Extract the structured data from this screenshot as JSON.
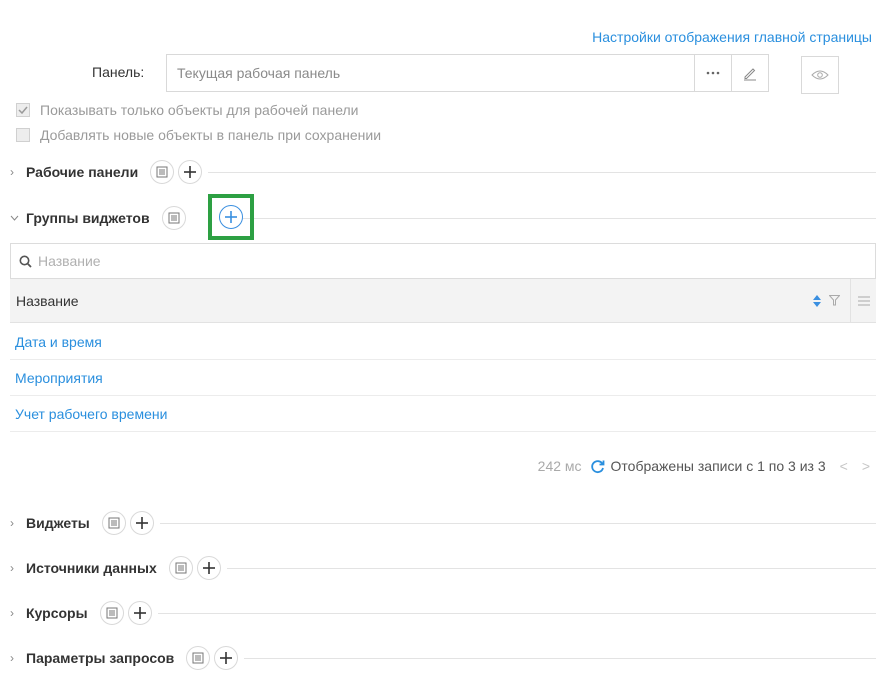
{
  "header": {
    "settings_link": "Настройки отображения главной страницы"
  },
  "panel": {
    "label": "Панель:",
    "value": "Текущая рабочая панель",
    "more_icon": "ellipsis-icon",
    "edit_icon": "pencil-icon",
    "view_icon": "eye-icon"
  },
  "options": {
    "show_only_panel_objects": {
      "label": "Показывать только объекты для рабочей панели",
      "checked": true
    },
    "add_new_to_panel": {
      "label": "Добавлять новые объекты в панель при сохранении",
      "checked": false
    }
  },
  "sections": {
    "panels": {
      "title": "Рабочие панели",
      "expanded": false
    },
    "groups": {
      "title": "Группы виджетов",
      "expanded": true
    },
    "widgets": {
      "title": "Виджеты",
      "expanded": false
    },
    "sources": {
      "title": "Источники данных",
      "expanded": false
    },
    "cursors": {
      "title": "Курсоры",
      "expanded": false
    },
    "params": {
      "title": "Параметры запросов",
      "expanded": false
    }
  },
  "groups_table": {
    "search_placeholder": "Название",
    "columns": [
      "Название"
    ],
    "rows": [
      {
        "name": "Дата и время"
      },
      {
        "name": "Мероприятия"
      },
      {
        "name": "Учет рабочего времени"
      }
    ],
    "footer": {
      "timing": "242 мс",
      "records_text": "Отображены записи с 1 по 3 из 3",
      "prev": "<",
      "next": ">"
    }
  },
  "colors": {
    "link": "#2a8fde",
    "highlight": "#2da043",
    "active_add": "#3a8fe0"
  }
}
